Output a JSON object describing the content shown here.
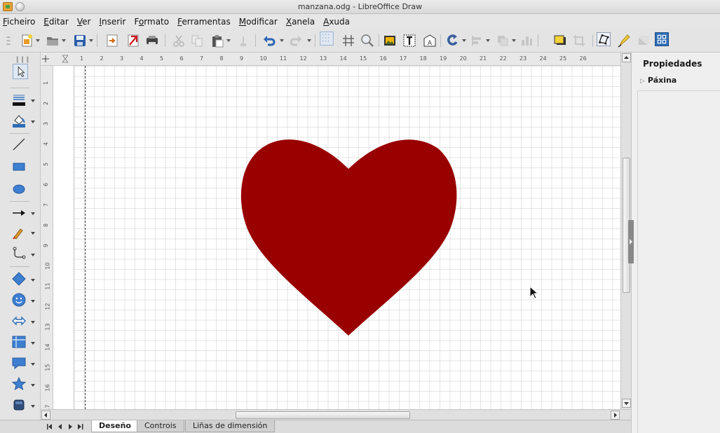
{
  "window": {
    "title": "manzana.odg - LibreOffice Draw"
  },
  "menu": [
    {
      "pre": "",
      "u": "F",
      "post": "icheiro"
    },
    {
      "pre": "",
      "u": "E",
      "post": "ditar"
    },
    {
      "pre": "",
      "u": "V",
      "post": "er"
    },
    {
      "pre": "",
      "u": "I",
      "post": "nserir"
    },
    {
      "pre": "F",
      "u": "o",
      "post": "rmato"
    },
    {
      "pre": "",
      "u": "F",
      "post": "erramentas"
    },
    {
      "pre": "",
      "u": "M",
      "post": "odificar"
    },
    {
      "pre": "",
      "u": "X",
      "post": "anela"
    },
    {
      "pre": "",
      "u": "A",
      "post": "xuda"
    }
  ],
  "ruler": {
    "h_numbers": [
      "1",
      "2",
      "3",
      "4",
      "5",
      "6",
      "7",
      "8",
      "9",
      "10",
      "11",
      "12",
      "13",
      "14",
      "15",
      "16",
      "17",
      "18",
      "19",
      "20",
      "21",
      "22",
      "23",
      "24",
      "25",
      "26"
    ],
    "v_numbers": [
      "1",
      "2",
      "3",
      "4",
      "5",
      "6",
      "7",
      "8",
      "9",
      "10",
      "11",
      "12",
      "13",
      "14",
      "15",
      "16",
      "17"
    ]
  },
  "tabs": {
    "nav": "◀ ◂ ▸ ▶",
    "items": [
      "Deseño",
      "Controis",
      "Liñas de dimensión"
    ],
    "active": 0
  },
  "sidebar": {
    "title": "Propiedades",
    "section": "Páxina"
  },
  "shape": {
    "type": "heart",
    "fill": "#990000"
  },
  "colors": {
    "accent": "#4a7ebb"
  }
}
